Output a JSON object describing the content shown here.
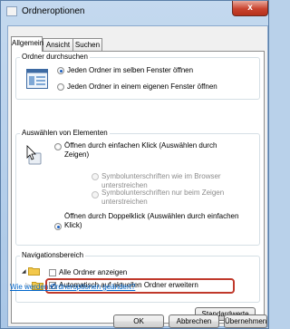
{
  "window": {
    "title": "Ordneroptionen",
    "close_label": "x"
  },
  "tabs": [
    {
      "label": "Allgemein",
      "active": true
    },
    {
      "label": "Ansicht",
      "active": false
    },
    {
      "label": "Suchen",
      "active": false
    }
  ],
  "browse_folders": {
    "label": "Ordner durchsuchen",
    "options": [
      {
        "label": "Jeden Ordner im selben Fenster öffnen",
        "selected": true
      },
      {
        "label": "Jeden Ordner in einem eigenen Fenster öffnen",
        "selected": false
      }
    ]
  },
  "click_items": {
    "label": "Auswählen von Elementen",
    "single_click_line1": "Öffnen durch einfachen Klick (Auswählen durch",
    "single_click_line2": "Zeigen)",
    "underline_browser": "Symbolunterschriften wie im Browser unterstreichen",
    "underline_hover_line1": "Symbolunterschriften nur beim Zeigen",
    "underline_hover_line2": "unterstreichen",
    "double_click_line1": "Öffnen durch Doppelklick (Auswählen durch einfachen",
    "double_click_line2": "Klick)",
    "selected": "double_click"
  },
  "navigation_pane": {
    "label": "Navigationsbereich",
    "show_all_folders": "Alle Ordner anzeigen",
    "auto_expand": "Automatisch auf aktuellen Ordner erweitern",
    "auto_expand_checked": true
  },
  "buttons": {
    "restore_defaults": "Standardwerte",
    "ok": "OK",
    "cancel": "Abbrechen",
    "apply": "Übernehmen"
  },
  "help_link": "Wie werden Ordneroptionen geändert?",
  "colors": {
    "accent": "#1a5ec0",
    "highlight": "#c0392b",
    "link": "#0066cc"
  }
}
